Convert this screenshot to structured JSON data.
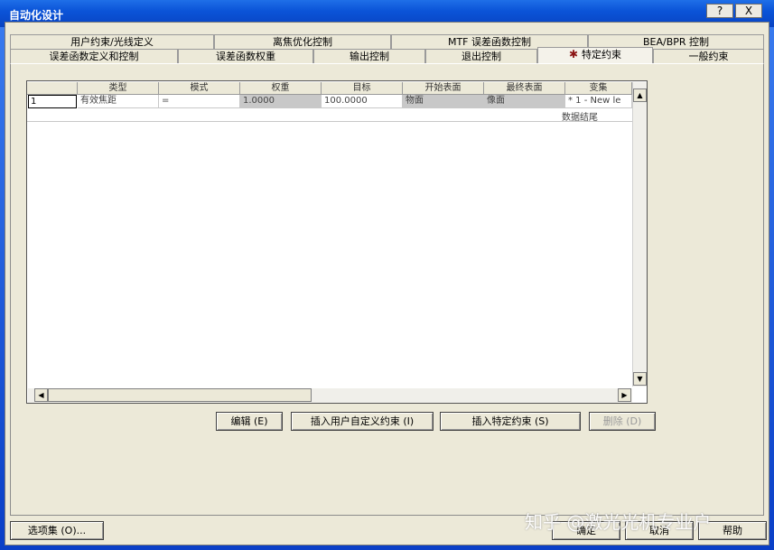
{
  "window": {
    "title": "自动化设计",
    "help_glyph": "?",
    "close_glyph": "X"
  },
  "tabs": {
    "row1": [
      "用户约束/光线定义",
      "离焦优化控制",
      "MTF 误差函数控制",
      "BEA/BPR 控制"
    ],
    "row2": [
      "误差函数定义和控制",
      "误差函数权重",
      "输出控制",
      "退出控制",
      "特定约束",
      "一般约束"
    ],
    "active": "特定约束",
    "active_icon": "star-icon"
  },
  "grid": {
    "headers": [
      "类型",
      "模式",
      "权重",
      "目标",
      "开始表面",
      "最终表面",
      "变集"
    ],
    "row": {
      "num": "1",
      "type": "有效焦距",
      "mode": "=",
      "weight": "1.0000",
      "target": "100.0000",
      "start_surface": "物面",
      "end_surface": "像面",
      "zoom": "*   1 - New le"
    },
    "end_text": "数据结尾"
  },
  "buttons": {
    "edit": "编辑 (E)",
    "insert_user": "插入用户自定义约束 (I)",
    "insert_specific": "插入特定约束 (S)",
    "delete": "删除 (D)",
    "options": "选项集 (O)...",
    "ok": "确定",
    "cancel": "取消",
    "help": "帮助"
  },
  "watermark": "知乎 @激光光机专业户",
  "colors": {
    "title_bar": "#0b54d8",
    "face": "#ece9d8",
    "gray_cell": "#c8c8c8"
  }
}
